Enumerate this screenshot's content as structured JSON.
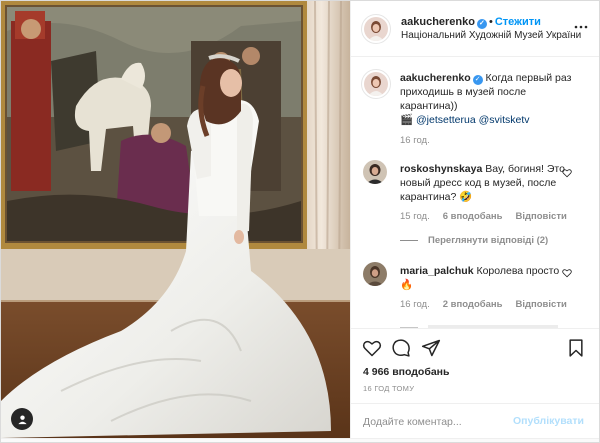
{
  "post": {
    "username": "aakucherenko",
    "follow_label": "Стежити",
    "location": "Національний Художній Музей України",
    "likes": "4 966 вподобань",
    "time_ago": "16 ГОД ТОМУ"
  },
  "caption": {
    "username": "aakucherenko",
    "text": "Когда первый раз приходишь в музей после карантина))",
    "emoji": "🎬",
    "mentions": "@jetsetterua @svitsketv",
    "time": "16 год."
  },
  "comments": [
    {
      "username": "roskoshynskaya",
      "text": "Вау, богиня! Это новый дресс код в музей, после карантина? 🤣",
      "time": "15 год.",
      "likes": "6 вподобань",
      "reply_label": "Відповісти",
      "view_replies": "Переглянути відповіді (2)"
    },
    {
      "username": "maria_palchuk",
      "text": "Королева просто 🔥",
      "time": "16 год.",
      "likes": "2 вподобань",
      "reply_label": "Відповісти"
    }
  ],
  "comment_box": {
    "placeholder": "Додайте коментар...",
    "publish_label": "Опублікувати"
  },
  "icons": {
    "like": "heart-icon",
    "comment": "comment-bubble-icon",
    "share": "paper-plane-icon",
    "save": "bookmark-icon",
    "more": "more-options-icon",
    "user_tags": "user-tag-icon"
  },
  "colors": {
    "link_blue": "#0095f6",
    "verified_blue": "#3897f0",
    "mention_blue": "#00376b",
    "muted_text": "#8e8e8e"
  }
}
